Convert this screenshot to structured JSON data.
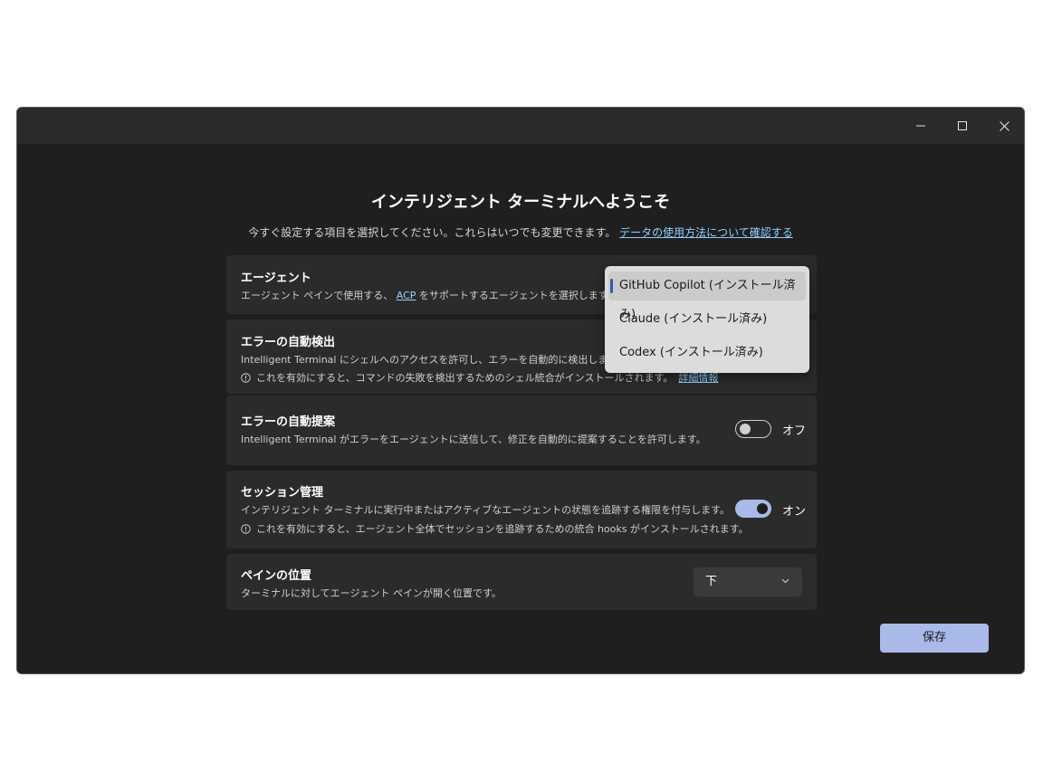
{
  "window": {
    "controls": {
      "minimize": "minimize-icon",
      "maximize": "maximize-icon",
      "close": "close-icon"
    }
  },
  "header": {
    "title": "インテリジェント ターミナルへようこそ",
    "subtitle": "今すぐ設定する項目を選択してください。これらはいつでも変更できます。",
    "link": "データの使用方法について確認する"
  },
  "agent": {
    "title": "エージェント",
    "desc_before": "エージェント ペインで使用する、",
    "desc_link": "ACP",
    "desc_after": " をサポートするエージェントを選択します。",
    "options": [
      "GitHub Copilot (インストール済み)",
      "Claude (インストール済み)",
      "Codex (インストール済み)"
    ],
    "selected_index": 0
  },
  "error_detection": {
    "title": "エラーの自動検出",
    "desc": "Intelligent Terminal にシェルへのアクセスを許可し、エラーを自動的に検出します。",
    "note": "これを有効にすると、コマンドの失敗を検出するためのシェル統合がインストールされます。",
    "note_link": "詳細情報"
  },
  "error_suggestion": {
    "title": "エラーの自動提案",
    "desc": "Intelligent Terminal がエラーをエージェントに送信して、修正を自動的に提案することを許可します。",
    "toggle_label": "オフ",
    "toggle_on": false
  },
  "session": {
    "title": "セッション管理",
    "desc": "インテリジェント ターミナルに実行中またはアクティブなエージェントの状態を追跡する権限を付与します。",
    "note": "これを有効にすると、エージェント全体でセッションを追跡するための統合 hooks がインストールされます。",
    "toggle_label": "オン",
    "toggle_on": true
  },
  "pane_position": {
    "title": "ペインの位置",
    "desc": "ターミナルに対してエージェント ペインが開く位置です。",
    "selected_value": "下"
  },
  "footer": {
    "save_label": "保存"
  },
  "colors": {
    "accent": "#a9b9e8",
    "link": "#8fd0ff",
    "card": "#2b2b2b",
    "background": "#1f1f1f"
  }
}
